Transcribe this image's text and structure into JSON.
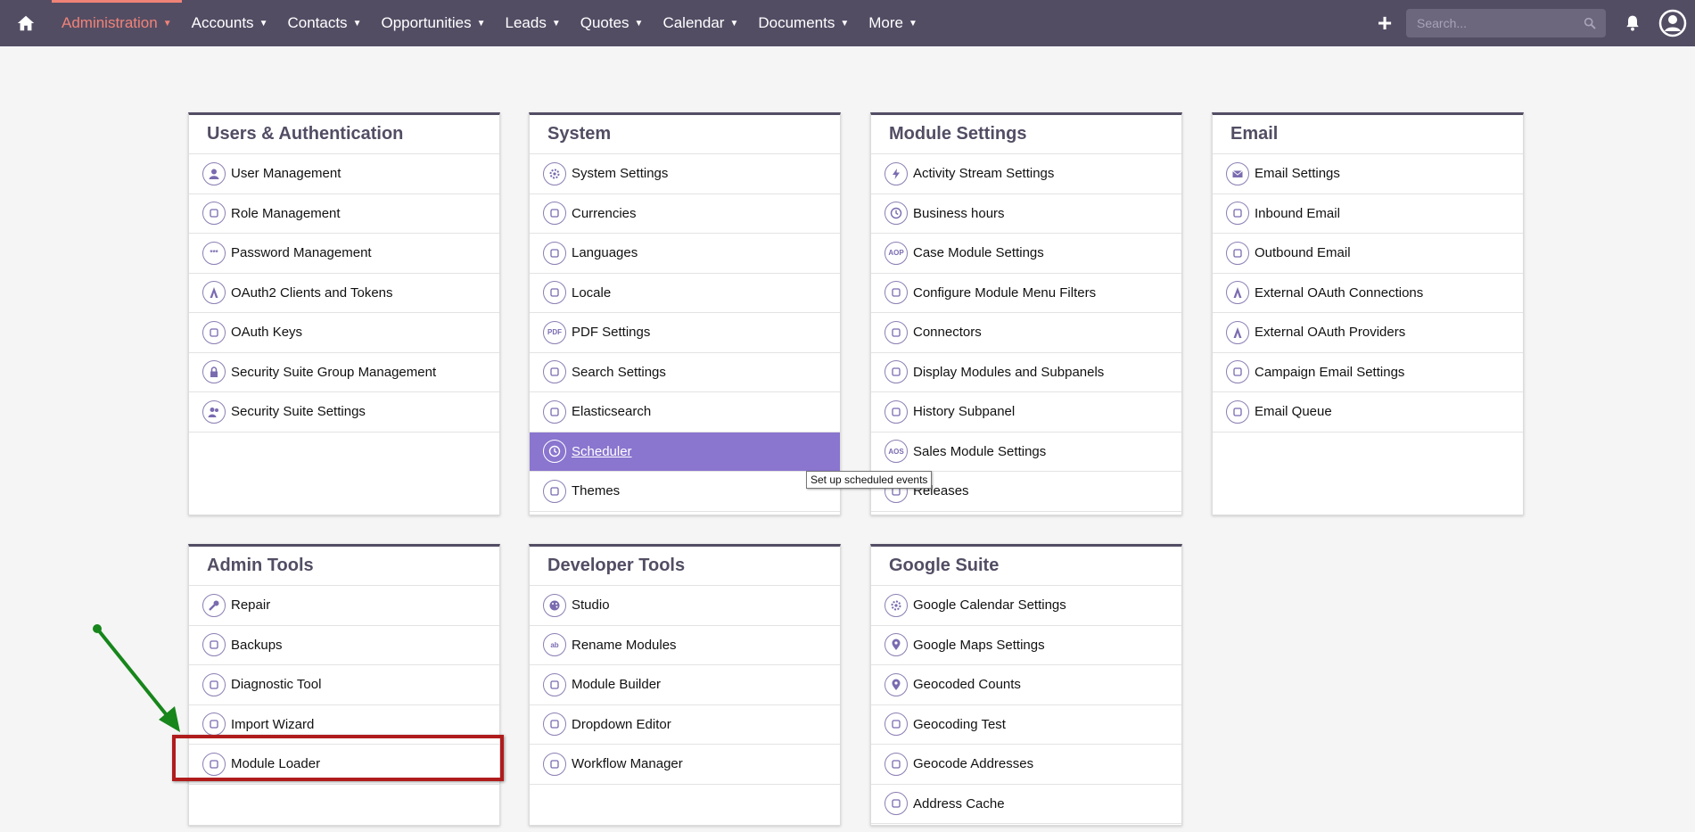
{
  "nav": {
    "home_icon": "home-icon",
    "items": [
      {
        "label": "Administration",
        "active": true
      },
      {
        "label": "Accounts"
      },
      {
        "label": "Contacts"
      },
      {
        "label": "Opportunities"
      },
      {
        "label": "Leads"
      },
      {
        "label": "Quotes"
      },
      {
        "label": "Calendar"
      },
      {
        "label": "Documents"
      },
      {
        "label": "More"
      }
    ],
    "search_placeholder": "Search...",
    "colors": {
      "bar": "#534d64",
      "active": "#f08377"
    }
  },
  "panels": [
    {
      "title": "Users & Authentication",
      "items": [
        {
          "label": "User Management",
          "icon": "user-icon"
        },
        {
          "label": "Role Management",
          "icon": "role-icon"
        },
        {
          "label": "Password Management",
          "icon": "password-icon"
        },
        {
          "label": "OAuth2 Clients and Tokens",
          "icon": "oauth-icon"
        },
        {
          "label": "OAuth Keys",
          "icon": "key-icon"
        },
        {
          "label": "Security Suite Group Management",
          "icon": "lock-icon"
        },
        {
          "label": "Security Suite Settings",
          "icon": "users-group-icon"
        }
      ]
    },
    {
      "title": "System",
      "items": [
        {
          "label": "System Settings",
          "icon": "gear-icon"
        },
        {
          "label": "Currencies",
          "icon": "currency-icon"
        },
        {
          "label": "Languages",
          "icon": "speech-bubble-icon"
        },
        {
          "label": "Locale",
          "icon": "location-arrow-icon"
        },
        {
          "label": "PDF Settings",
          "icon": "pdf-icon"
        },
        {
          "label": "Search Settings",
          "icon": "search-settings-icon"
        },
        {
          "label": "Elasticsearch",
          "icon": "elasticsearch-icon"
        },
        {
          "label": "Scheduler",
          "icon": "clock-icon",
          "highlight": true
        },
        {
          "label": "Themes",
          "icon": "themes-icon"
        }
      ]
    },
    {
      "title": "Module Settings",
      "items": [
        {
          "label": "Activity Stream Settings",
          "icon": "lightning-icon"
        },
        {
          "label": "Business hours",
          "icon": "clock-icon"
        },
        {
          "label": "Case Module Settings",
          "icon": "aop-icon"
        },
        {
          "label": "Configure Module Menu Filters",
          "icon": "sliders-icon"
        },
        {
          "label": "Connectors",
          "icon": "connectors-icon"
        },
        {
          "label": "Display Modules and Subpanels",
          "icon": "monitor-icon"
        },
        {
          "label": "History Subpanel",
          "icon": "history-icon"
        },
        {
          "label": "Sales Module Settings",
          "icon": "aos-icon"
        },
        {
          "label": "Releases",
          "icon": "releases-icon"
        }
      ]
    },
    {
      "title": "Email",
      "items": [
        {
          "label": "Email Settings",
          "icon": "envelope-icon"
        },
        {
          "label": "Inbound Email",
          "icon": "inbound-email-icon"
        },
        {
          "label": "Outbound Email",
          "icon": "outbound-email-icon"
        },
        {
          "label": "External OAuth Connections",
          "icon": "oauth-icon"
        },
        {
          "label": "External OAuth Providers",
          "icon": "oauth-icon"
        },
        {
          "label": "Campaign Email Settings",
          "icon": "campaign-sliders-icon"
        },
        {
          "label": "Email Queue",
          "icon": "snail-icon"
        }
      ]
    },
    {
      "title": "Admin Tools",
      "items": [
        {
          "label": "Repair",
          "icon": "wrench-icon"
        },
        {
          "label": "Backups",
          "icon": "backup-icon"
        },
        {
          "label": "Diagnostic Tool",
          "icon": "diagnostic-icon"
        },
        {
          "label": "Import Wizard",
          "icon": "import-icon"
        },
        {
          "label": "Module Loader",
          "icon": "loader-icon"
        }
      ]
    },
    {
      "title": "Developer Tools",
      "items": [
        {
          "label": "Studio",
          "icon": "palette-icon"
        },
        {
          "label": "Rename Modules",
          "icon": "ab-icon"
        },
        {
          "label": "Module Builder",
          "icon": "module-builder-icon"
        },
        {
          "label": "Dropdown Editor",
          "icon": "dropdown-icon"
        },
        {
          "label": "Workflow Manager",
          "icon": "workflow-icon"
        }
      ]
    },
    {
      "title": "Google Suite",
      "items": [
        {
          "label": "Google Calendar Settings",
          "icon": "gear-icon"
        },
        {
          "label": "Google Maps Settings",
          "icon": "map-pin-icon"
        },
        {
          "label": "Geocoded Counts",
          "icon": "map-pin-icon"
        },
        {
          "label": "Geocoding Test",
          "icon": "geocode-test-icon"
        },
        {
          "label": "Geocode Addresses",
          "icon": "geocode-icon"
        },
        {
          "label": "Address Cache",
          "icon": "address-cache-icon"
        }
      ]
    }
  ],
  "tooltip": "Set up scheduled events",
  "annotation": {
    "box_color": "#b01c1c",
    "arrow_color": "#17861b"
  }
}
